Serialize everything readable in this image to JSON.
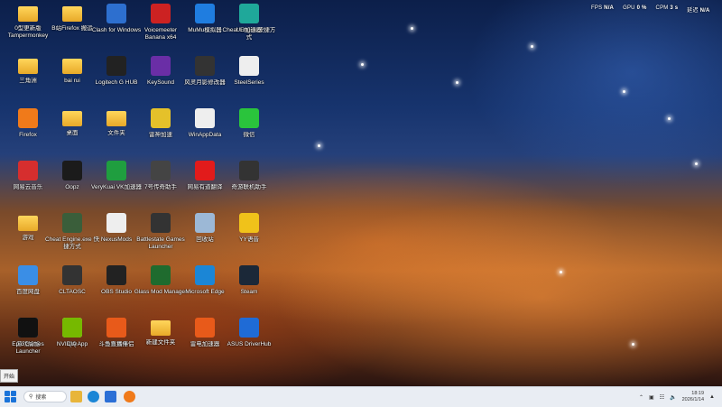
{
  "hud": {
    "fps_label": "FPS",
    "fps_value": "N/A",
    "gpu_label": "GPU",
    "gpu_value": "0 %",
    "cpm_label": "CPM",
    "cpm_value": "3 s",
    "extra_label": "延迟",
    "extra_value": "N/A"
  },
  "desktop": {
    "icons": [
      {
        "label": "0型更新版Tampermonkey",
        "icon": "folder",
        "color": "#e8a928"
      },
      {
        "label": "Clash for Windows",
        "icon": "clash-icon",
        "color": "#2d6fcf"
      },
      {
        "label": "Voicemeeter Banana x64",
        "icon": "voicemeeter-icon",
        "color": "#c22"
      },
      {
        "label": "MuMu模拟器",
        "icon": "mumu-icon",
        "color": "#1f7de0"
      },
      {
        "label": "Cheat Engine快捷方式",
        "icon": "cheat-engine-icon",
        "color": "#8a2e2e"
      },
      {
        "label": "UU加速器",
        "icon": "uu-icon",
        "color": "#1fa89a"
      },
      {
        "label": "B站Firefox 搬运",
        "icon": "folder",
        "color": "#e8a928"
      },
      {
        "label": "三角洲",
        "icon": "folder",
        "color": "#e8a928"
      },
      {
        "label": "bai rui",
        "icon": "folder-user",
        "color": "#e8a928"
      },
      {
        "label": "Logitech G HUB",
        "icon": "logitech-icon",
        "color": "#222"
      },
      {
        "label": "KeySound",
        "icon": "keysound-icon",
        "color": "#6a2ea6"
      },
      {
        "label": "风灵月影修改器",
        "icon": "trainer-icon",
        "color": "#333"
      },
      {
        "label": "SteelSeries",
        "icon": "steelseries-icon",
        "color": "#eee"
      },
      {
        "label": "Firefox",
        "icon": "firefox-icon",
        "color": "#f07a1a"
      },
      {
        "label": "桌面",
        "icon": "folder",
        "color": "#e8a928"
      },
      {
        "label": "文件夹",
        "icon": "folder-cyan",
        "color": "#2ab0c8"
      },
      {
        "label": "雷神加速",
        "icon": "leishen-icon",
        "color": "#e5c12a"
      },
      {
        "label": "WinAppData",
        "icon": "file-icon",
        "color": "#eee"
      },
      {
        "label": "微信",
        "icon": "wechat-icon",
        "color": "#2ac43c"
      },
      {
        "label": "网易云音乐",
        "icon": "netease-music-icon",
        "color": "#d62e2e"
      },
      {
        "label": "Oopz",
        "icon": "oopz-icon",
        "color": "#1b1b1b"
      },
      {
        "label": "VeryKuai VK加速器",
        "icon": "verykuai-icon",
        "color": "#1f9e3f"
      },
      {
        "label": "7号传奇助手",
        "icon": "gauge-icon",
        "color": "#444"
      },
      {
        "label": "网易有道翻译",
        "icon": "youdao-icon",
        "color": "#e21b1b"
      },
      {
        "label": "奇游联机助手",
        "icon": "qiyou-icon",
        "color": "#333"
      },
      {
        "label": "游戏",
        "icon": "folder",
        "color": "#e8a928"
      },
      {
        "label": "Cheat Engine.exe 快捷方式",
        "icon": "cheat-engine-exe-icon",
        "color": "#3a5e3a"
      },
      {
        "label": "NexusMods",
        "icon": "file-icon",
        "color": "#eee"
      },
      {
        "label": "Battlestate Games Launcher",
        "icon": "battlestate-icon",
        "color": "#333"
      },
      {
        "label": "回收站",
        "icon": "recycle-bin-icon",
        "color": "#9cb8d6"
      },
      {
        "label": "YY语音",
        "icon": "yy-icon",
        "color": "#f0c21a"
      },
      {
        "label": "百度网盘",
        "icon": "baidu-netdisk-icon",
        "color": "#3a8ee6"
      },
      {
        "label": "CLTAOSC",
        "icon": "game-icon",
        "color": "#333"
      },
      {
        "label": "OBS Studio",
        "icon": "obs-icon",
        "color": "#222"
      },
      {
        "label": "Glass Mod Manager",
        "icon": "gmm-icon",
        "color": "#1f6b2e"
      },
      {
        "label": "Microsoft Edge",
        "icon": "edge-icon",
        "color": "#1b86d6"
      },
      {
        "label": "Steam",
        "icon": "steam-icon",
        "color": "#1b2838"
      },
      {
        "label": "游戏加加",
        "icon": "youxijiajia-icon",
        "color": "#1f9ee6"
      },
      {
        "label": "QQ",
        "icon": "qq-icon",
        "color": "#eee"
      },
      {
        "label": "斗鱼直播",
        "icon": "douyu-icon",
        "color": "#e85a1a"
      },
      {
        "label": "新建文件夹",
        "icon": "folder",
        "color": "#e8a928"
      },
      {
        "label": "雷电加速器",
        "icon": "leidian-icon",
        "color": "#e85a1a"
      },
      {
        "label": "ASUS DriverHub",
        "icon": "asus-icon",
        "color": "#1f6bd6"
      },
      {
        "label": "Epic Games Launcher",
        "icon": "epic-icon",
        "color": "#111"
      },
      {
        "label": "NVIDIA App",
        "icon": "nvidia-icon",
        "color": "#76b900"
      },
      {
        "label": "斗鱼直播伴侣",
        "icon": "douyu-icon",
        "color": "#e85a1a"
      }
    ]
  },
  "start_tooltip": "开始",
  "taskbar": {
    "search_placeholder": "搜索",
    "pinned": [
      {
        "name": "file-explorer-icon",
        "color": "#e8b53a"
      },
      {
        "name": "edge-icon",
        "color": "#1b86d6"
      },
      {
        "name": "store-icon",
        "color": "#2b6fd6"
      },
      {
        "name": "firefox-icon",
        "color": "#f07a1a"
      }
    ],
    "clock_time": "18:19",
    "clock_date": "2026/1/14"
  }
}
